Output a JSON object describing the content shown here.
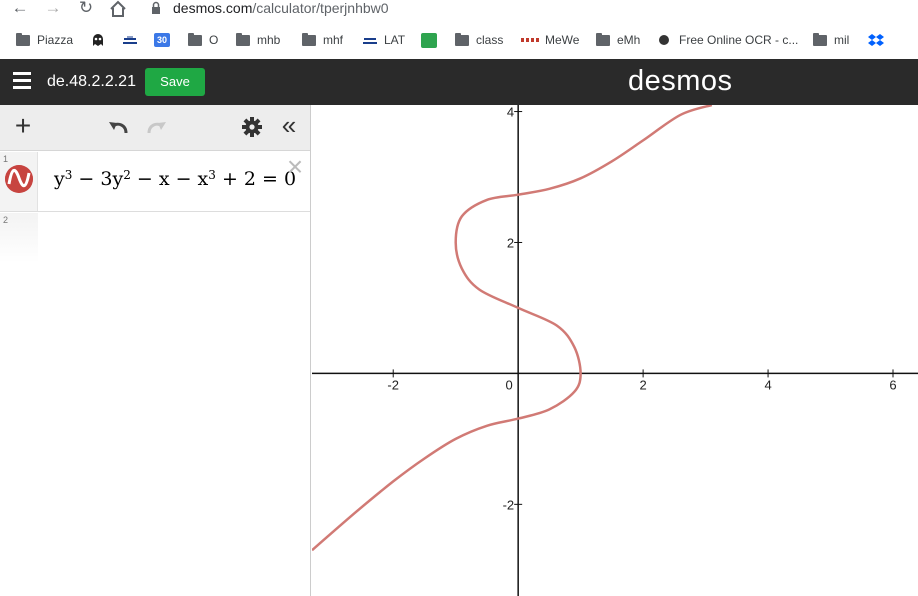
{
  "browser": {
    "url_host": "desmos.com",
    "url_path": "/calculator/tperjnhbw0",
    "icons": [
      "back-arrow-icon",
      "forward-arrow-icon",
      "reload-icon",
      "home-icon",
      "lock-icon"
    ]
  },
  "bookmarks": [
    {
      "label": "Piazza",
      "icon": "folder-icon"
    },
    {
      "label": "",
      "icon": "ghost-favicon"
    },
    {
      "label": "",
      "icon": "ship-favicon"
    },
    {
      "label": "30",
      "icon": "calendar-favicon"
    },
    {
      "label": "O",
      "icon": "folder-icon"
    },
    {
      "label": "mhb",
      "icon": "folder-icon"
    },
    {
      "label": "mhf",
      "icon": "folder-icon"
    },
    {
      "label": "LAT",
      "icon": "ship-favicon"
    },
    {
      "label": "",
      "icon": "green-favicon"
    },
    {
      "label": "class",
      "icon": "folder-icon"
    },
    {
      "label": "MeWe",
      "icon": "mewe-favicon"
    },
    {
      "label": "eMh",
      "icon": "folder-icon"
    },
    {
      "label": "Free Online OCR - c...",
      "icon": "ocr-favicon"
    },
    {
      "label": "mil",
      "icon": "folder-icon"
    },
    {
      "label": "",
      "icon": "dropbox-favicon"
    }
  ],
  "header": {
    "title": "de.48.2.2.21",
    "save_label": "Save",
    "brand": "desmos",
    "colors": {
      "bar": "#2a2a2a",
      "save": "#1fa844"
    }
  },
  "expressions": [
    {
      "number": "1",
      "latex_parts": [
        "y",
        "3",
        " − 3y",
        "2",
        " − x − x",
        "3",
        " + 2 = 0"
      ],
      "color": "#c74440"
    },
    {
      "number": "2",
      "latex_parts": []
    }
  ],
  "chart_data": {
    "type": "line",
    "title": "",
    "xlabel": "",
    "ylabel": "",
    "xlim": [
      -3.3,
      6.4
    ],
    "ylim": [
      -3.4,
      4.1
    ],
    "x_ticks": [
      -2,
      0,
      2,
      4,
      6
    ],
    "y_ticks": [
      -2,
      2,
      4
    ],
    "grid": false,
    "series": [
      {
        "equation": "y^3 - 3y^2 - x - x^3 + 2 = 0",
        "color": "#d17a75",
        "points": [
          [
            -3.3,
            -2.7
          ],
          [
            -2.6,
            -2.12
          ],
          [
            -2.0,
            -1.65
          ],
          [
            -1.5,
            -1.3
          ],
          [
            -1.0,
            -1.0
          ],
          [
            -0.5,
            -0.8
          ],
          [
            0.0,
            -0.69
          ],
          [
            0.5,
            -0.55
          ],
          [
            0.9,
            -0.28
          ],
          [
            1.0,
            0.0
          ],
          [
            0.9,
            0.4
          ],
          [
            0.62,
            0.73
          ],
          [
            0.0,
            1.0
          ],
          [
            -0.62,
            1.28
          ],
          [
            -0.9,
            1.6
          ],
          [
            -1.0,
            2.0
          ],
          [
            -0.9,
            2.4
          ],
          [
            -0.5,
            2.65
          ],
          [
            0.0,
            2.73
          ],
          [
            0.5,
            2.82
          ],
          [
            1.0,
            2.98
          ],
          [
            1.5,
            3.24
          ],
          [
            2.0,
            3.56
          ],
          [
            2.6,
            3.95
          ],
          [
            3.1,
            4.1
          ]
        ]
      }
    ]
  }
}
